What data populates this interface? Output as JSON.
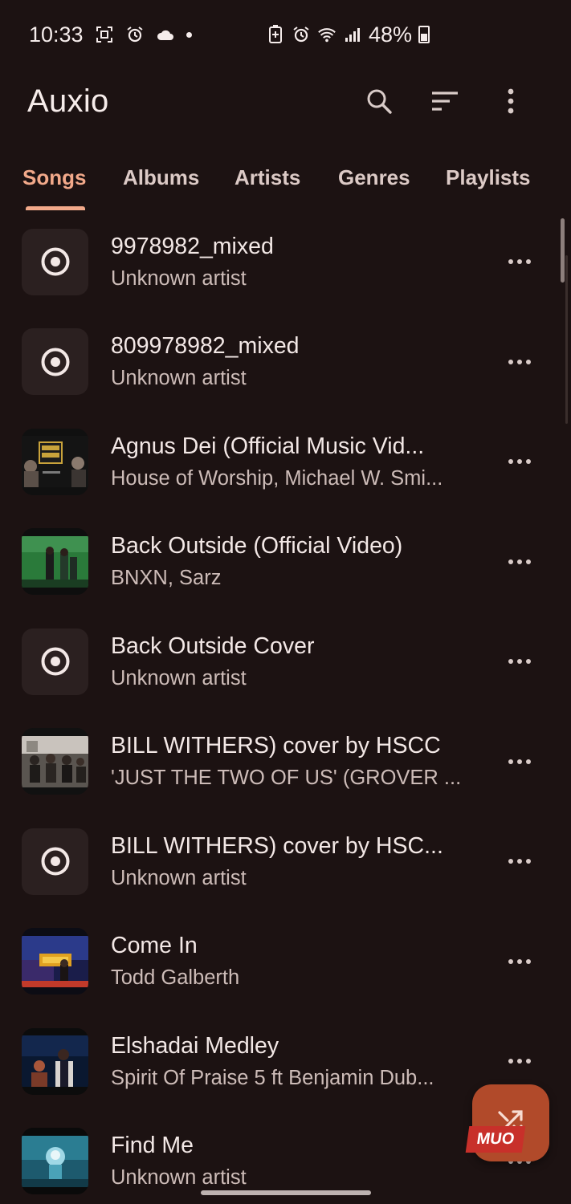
{
  "status_bar": {
    "time": "10:33",
    "battery": "48%",
    "icons_left": [
      "screenshot-icon",
      "alarm-icon",
      "cloud-icon",
      "dot-icon"
    ],
    "icons_right": [
      "battery-saver-icon",
      "alarm-icon",
      "wifi-icon",
      "signal-icon",
      "battery-icon"
    ]
  },
  "app_bar": {
    "title": "Auxio",
    "actions": [
      "search-icon",
      "sort-icon",
      "more-vert-icon"
    ]
  },
  "tabs": [
    {
      "label": "Songs",
      "active": true
    },
    {
      "label": "Albums",
      "active": false
    },
    {
      "label": "Artists",
      "active": false
    },
    {
      "label": "Genres",
      "active": false
    },
    {
      "label": "Playlists",
      "active": false
    }
  ],
  "songs": [
    {
      "title": "9978982_mixed",
      "artist": "Unknown artist",
      "cover": "default"
    },
    {
      "title": "809978982_mixed",
      "artist": "Unknown artist",
      "cover": "default"
    },
    {
      "title": "Agnus Dei (Official Music Vid...",
      "artist": "House of Worship, Michael W. Smi...",
      "cover": "art"
    },
    {
      "title": "Back Outside (Official Video)",
      "artist": "BNXN, Sarz",
      "cover": "art"
    },
    {
      "title": "Back Outside Cover",
      "artist": "Unknown artist",
      "cover": "default"
    },
    {
      "title": "BILL WITHERS) cover by HSCC",
      "artist": "'JUST THE TWO OF US' (GROVER ...",
      "cover": "art"
    },
    {
      "title": "BILL WITHERS) cover by HSC...",
      "artist": "Unknown artist",
      "cover": "default"
    },
    {
      "title": "Come In",
      "artist": "Todd Galberth",
      "cover": "art"
    },
    {
      "title": "Elshadai Medley",
      "artist": "Spirit Of Praise 5 ft Benjamin Dub...",
      "cover": "art"
    },
    {
      "title": "Find Me",
      "artist": "Unknown artist",
      "cover": "art"
    }
  ],
  "fab": {
    "icon": "shuffle-icon"
  },
  "watermark": "MUO",
  "colors": {
    "background": "#1c1212",
    "accent": "#f2a98a",
    "fab": "#b14a2a",
    "text_primary": "#f3e8e6",
    "text_secondary": "#cdbcb8"
  }
}
